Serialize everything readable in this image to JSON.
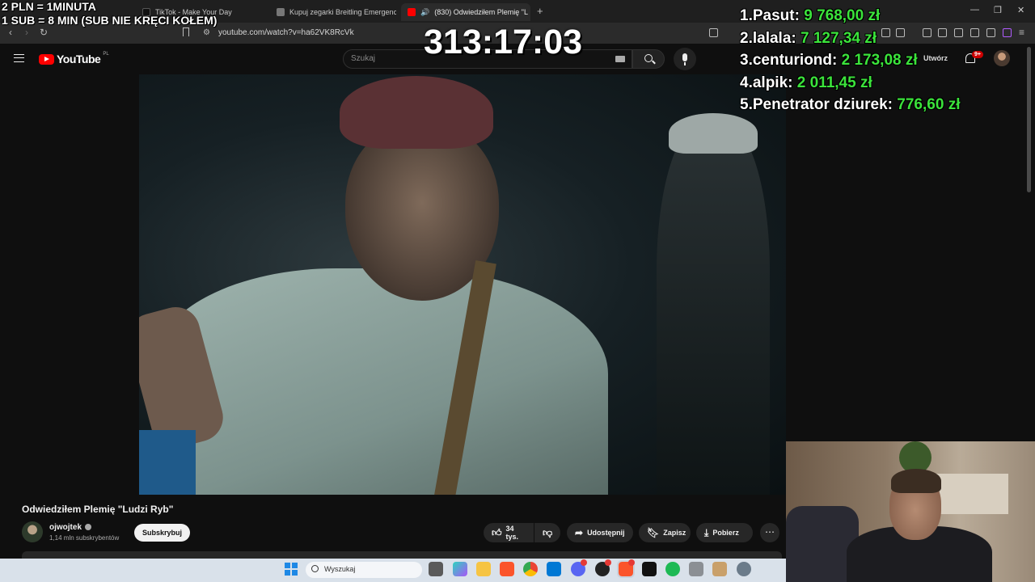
{
  "overlay": {
    "donation_line_1": "2 PLN = 1MINUTA",
    "donation_line_2": "1 SUB = 8 MIN (SUB NIE KRĘCI KOŁEM)",
    "timer": "313:17:03",
    "leaderboard": [
      {
        "rank": "1.",
        "name": "Pasut:",
        "amount": "9 768,00 zł"
      },
      {
        "rank": "2.",
        "name": "lalala:",
        "amount": "7 127,34 zł"
      },
      {
        "rank": "3.",
        "name": "centuriond:",
        "amount": "2 173,08 zł"
      },
      {
        "rank": "4.",
        "name": "alpik:",
        "amount": "2 011,45 zł"
      },
      {
        "rank": "5.",
        "name": "Penetrator dziurek:",
        "amount": "776,60 zł"
      }
    ]
  },
  "browser": {
    "tabs": [
      {
        "label": "TikTok - Make Your Day",
        "favicon_color": "#111111"
      },
      {
        "label": "Kupuj zegarki Breitling Emergency II",
        "favicon_color": "#888888"
      },
      {
        "label": "(830) Odwiedziłem Plemię \"L",
        "favicon_color": "#ff0000",
        "active": true
      }
    ],
    "new_tab": "+",
    "url": "youtube.com/watch?v=ha62VK8RcVk"
  },
  "youtube": {
    "logo_text": "YouTube",
    "region": "PL",
    "search_placeholder": "Szukaj",
    "upload_label": "Utwórz",
    "notification_count": "9+"
  },
  "video": {
    "title": "Odwiedziłem Plemię \"Ludzi Ryb\"",
    "channel": "ojwojtek",
    "subscribers": "1,14 mln subskrybentów",
    "subscribe_label": "Subskrybuj",
    "likes": "34 tys.",
    "share_label": "Udostępnij",
    "save_label": "Zapisz",
    "download_label": "Pobierz"
  },
  "taskbar": {
    "search_placeholder": "Wyszukaj"
  }
}
